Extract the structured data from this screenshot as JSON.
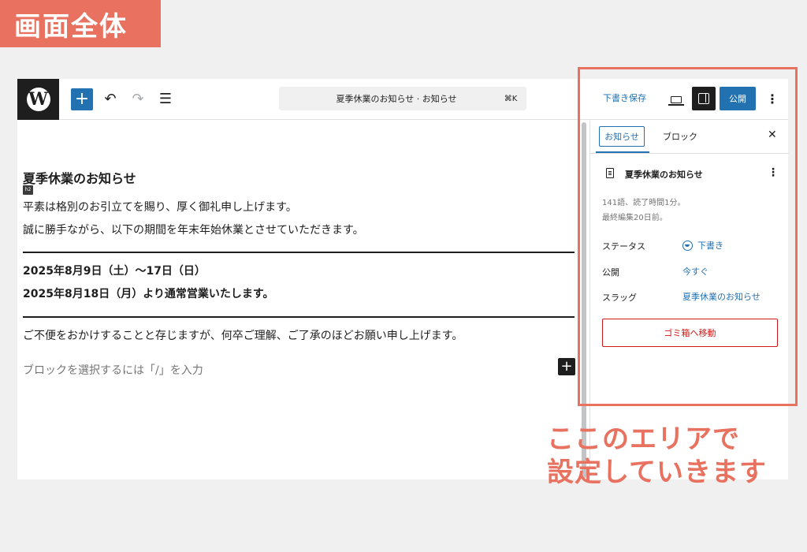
{
  "banner": {
    "title": "画面全体"
  },
  "toolbar": {
    "add_symbol": "+",
    "undo_symbol": "↶",
    "redo_symbol": "↷",
    "list_view_symbol": "☰",
    "command_title": "夏季休業のお知らせ · お知らせ",
    "command_shortcut": "⌘K",
    "save_draft_label": "下書き保存",
    "publish_label": "公開",
    "more_symbol": "⋮"
  },
  "post": {
    "title": "夏季休業のお知らせ",
    "heading_level_badge": "h2",
    "paragraphs": [
      "平素は格別のお引立てを賜り、厚く御礼申し上げます。",
      "誠に勝手ながら、以下の期間を年末年始休業とさせていただきます。"
    ],
    "dates": [
      "2025年8月9日（土）〜17日（日）",
      "2025年8月18日（月）より通常営業いたします。"
    ],
    "closing": "ご不便をおかけすることと存じますが、何卒ご理解、ご了承のほどお願い申し上げます。",
    "block_placeholder": "ブロックを選択するには「/」を入力",
    "inline_add_symbol": "+"
  },
  "sidebar": {
    "tabs": [
      {
        "label": "お知らせ",
        "active": true
      },
      {
        "label": "ブロック",
        "active": false
      }
    ],
    "close_symbol": "✕",
    "summary": {
      "title": "夏季休業のお知らせ",
      "more_symbol": "⋮",
      "word_count": "141語、読了時間1分。",
      "last_edited": "最終編集20日前。"
    },
    "rows": [
      {
        "label": "ステータス",
        "value": "下書き"
      },
      {
        "label": "公開",
        "value": "今すぐ"
      },
      {
        "label": "スラッグ",
        "value": "夏季休業のお知らせ"
      }
    ],
    "trash_label": "ゴミ箱へ移動"
  },
  "annotation": {
    "line1": "ここのエリアで",
    "line2": "設定していきます"
  },
  "colors": {
    "accent": "#e8715f",
    "wp_blue": "#2271b1",
    "danger": "#cc1818",
    "dark": "#1e1e1e"
  }
}
